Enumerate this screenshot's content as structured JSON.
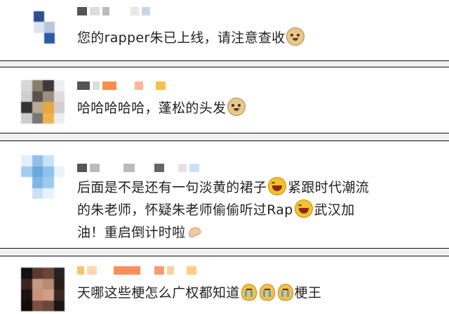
{
  "comments": [
    {
      "text_parts": [
        "您的rapper朱已上线，请注意查收",
        ""
      ],
      "emoji": [
        "doge-emoji"
      ]
    },
    {
      "text_parts": [
        "哈哈哈哈哈，蓬松的头发",
        ""
      ],
      "emoji": [
        "doge-emoji"
      ]
    },
    {
      "line1a": "后面是不是还有一句淡黄的裙子",
      "line1b": "紧跟时代潮流",
      "line2a": "的朱老师，怀疑朱老师偷偷听过Rap",
      "line2b": "武汉加",
      "line3": "油！重启倒计时啦"
    },
    {
      "text_a": "天哪这些梗怎么广权都知道",
      "text_b": "梗王"
    }
  ]
}
